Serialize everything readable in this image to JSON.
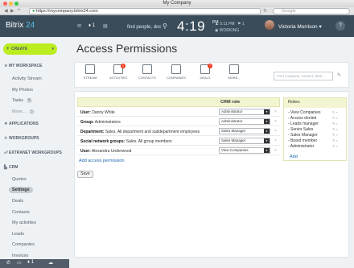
{
  "window": {
    "title": "My Company"
  },
  "browser": {
    "url": "https://mycompany.bitrix24.com",
    "search_placeholder": "Google"
  },
  "header": {
    "logo_text": "Bitrix",
    "logo_num": "24",
    "notif_count": "1",
    "search_text": "find people, doc",
    "clock": "4:19",
    "clock_pm": "PM",
    "clock_small_time": "5:11 PM",
    "clock_small_count": "1",
    "status": "WORKING",
    "user_name": "Victoria Morrison",
    "help": "?"
  },
  "sidebar": {
    "create": "CREATE",
    "sections": {
      "my_workspace": "MY WORKSPACE",
      "applications": "APPLICATIONS",
      "workgroups": "WORKGROUPS",
      "extranet": "EXTRANET WORKGROUPS",
      "crm": "CRM"
    },
    "workspace_items": {
      "activity": "Activity Stream",
      "photos": "My Photos",
      "tasks": "Tasks",
      "tasks_count": "5",
      "more": "More...",
      "more_count": "5"
    },
    "crm_items": [
      "Quotes",
      "Settings",
      "Deals",
      "Contacts",
      "My activities",
      "Leads",
      "Companies",
      "Invoices"
    ]
  },
  "page": {
    "title": "Access Permissions"
  },
  "toolbar": {
    "stream": "STREAM",
    "activities": "ACTIVITIES",
    "activities_badge": "1",
    "contacts": "CONTACTS",
    "companies": "COMPANIES",
    "deals": "DEALS",
    "deals_badge": "7",
    "more": "MORE...",
    "find_placeholder": "Find company, contact, deal..."
  },
  "table": {
    "crm_role_header": "CRM role",
    "rows": [
      {
        "type": "User:",
        "name": "Danny White",
        "role": "Administrator"
      },
      {
        "type": "Group:",
        "name": "Administrators",
        "role": "Administrator"
      },
      {
        "type": "Department:",
        "name": "Sales. All department and subdepartment employees",
        "role": "Sales Manager"
      },
      {
        "type": "Social network groups:",
        "name": "Sales. All group members",
        "role": "Sales Manager"
      },
      {
        "type": "User:",
        "name": "Alexandra Underwood",
        "role": "View Companies"
      }
    ],
    "add_permission": "Add access permission"
  },
  "roles": {
    "header": "Roles:",
    "items": [
      "- View Companies",
      "- Access denied",
      "- Leads manager",
      "- Senior Sales",
      "- Sales Manager",
      "- Board member",
      "- Administrator"
    ],
    "add": "Add"
  },
  "save_label": "Save"
}
